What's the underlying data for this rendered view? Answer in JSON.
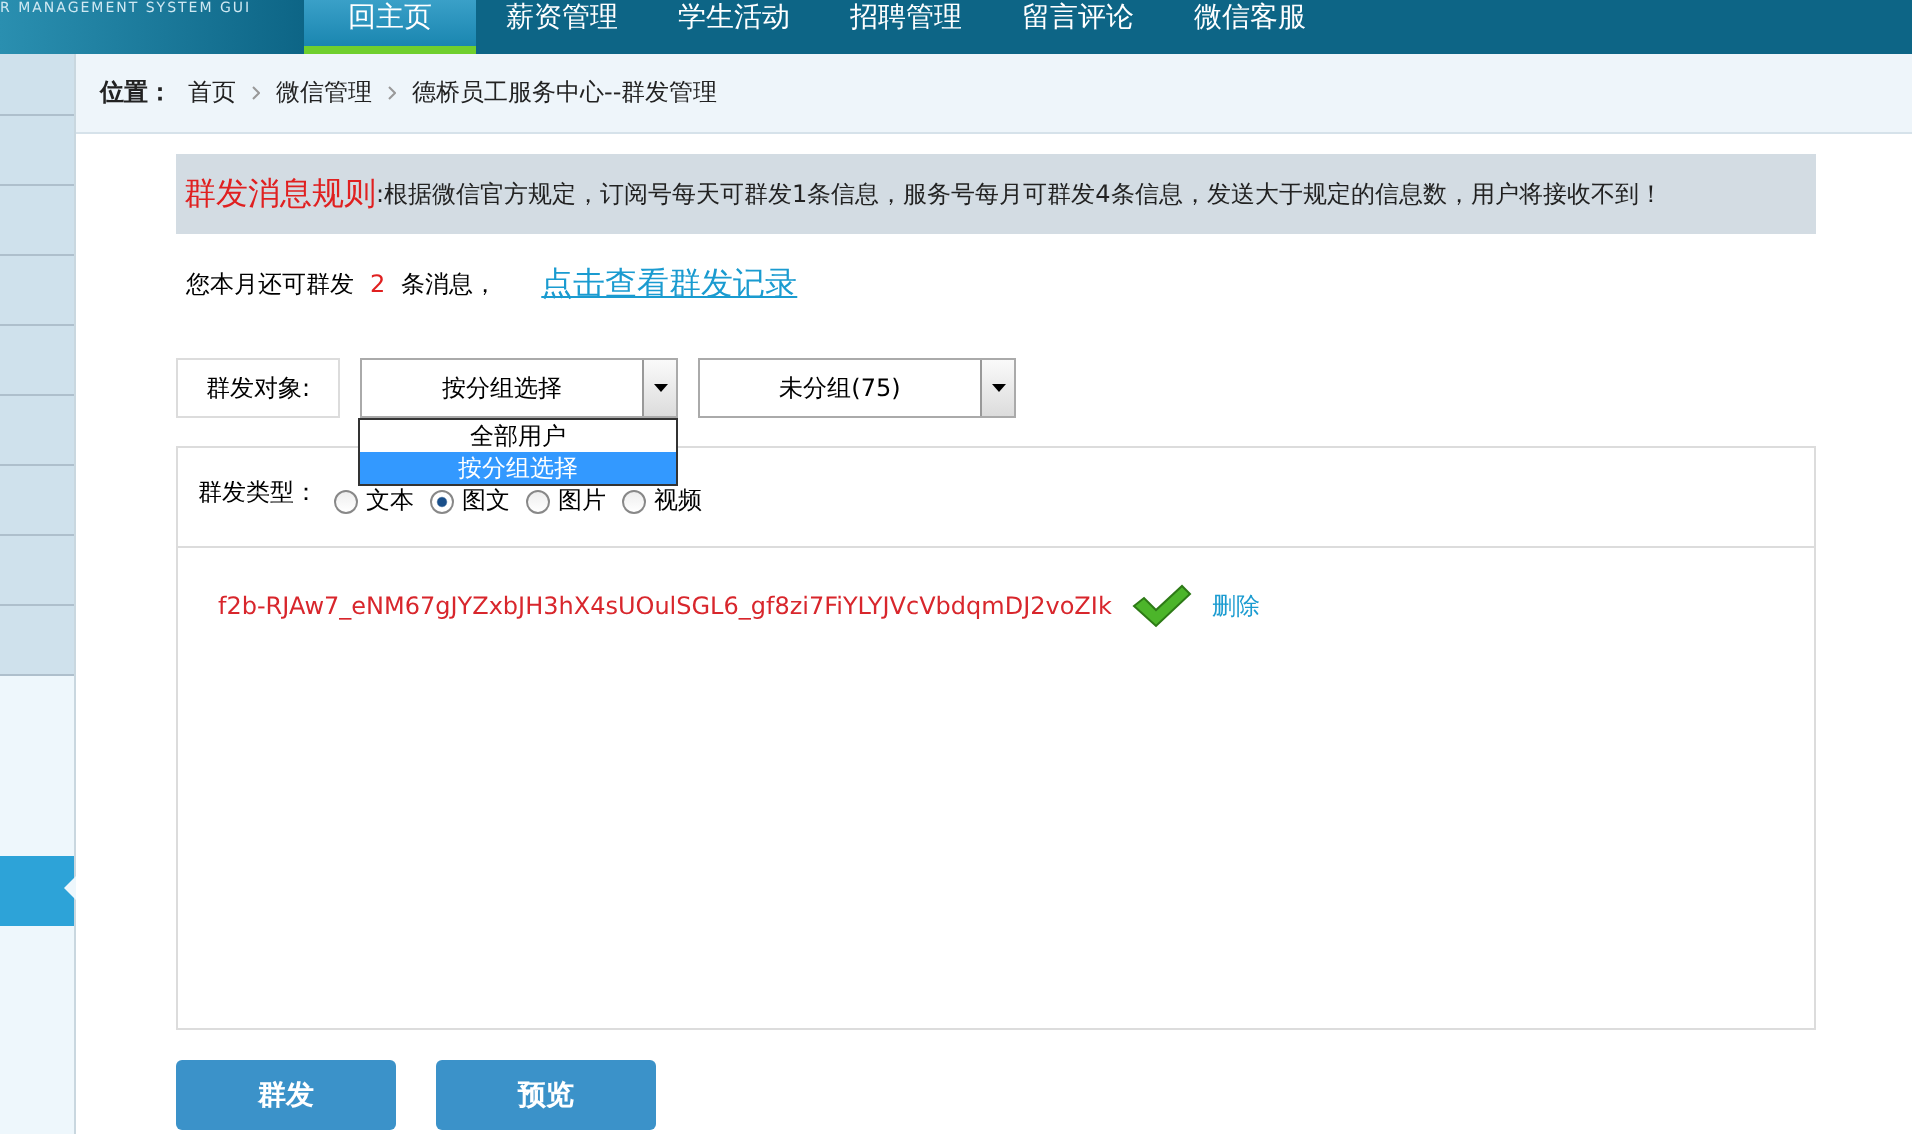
{
  "header": {
    "logo_text": "R MANAGEMENT SYSTEM GUI",
    "nav": [
      {
        "label": "回主页",
        "selected": true
      },
      {
        "label": "薪资管理",
        "selected": false
      },
      {
        "label": "学生活动",
        "selected": false
      },
      {
        "label": "招聘管理",
        "selected": false
      },
      {
        "label": "留言评论",
        "selected": false
      },
      {
        "label": "微信客服",
        "selected": false
      }
    ]
  },
  "sidebar": {
    "items": [
      {
        "selected": false
      },
      {
        "selected": false
      },
      {
        "selected": false
      },
      {
        "selected": false
      },
      {
        "selected": false
      },
      {
        "selected": false
      },
      {
        "selected": false
      },
      {
        "selected": false
      },
      {
        "selected": true
      }
    ]
  },
  "breadcrumb": {
    "label": "位置：",
    "items": [
      "首页",
      "微信管理",
      "德桥员工服务中心--群发管理"
    ]
  },
  "rule": {
    "title": "群发消息规则",
    "text": ":根据微信官方规定，订阅号每天可群发1条信息，服务号每月可群发4条信息，发送大于规定的信息数，用户将接收不到！"
  },
  "quota": {
    "prefix": "您本月还可群发",
    "count": "2",
    "suffix": "条消息，",
    "link": "点击查看群发记录"
  },
  "target": {
    "label": "群发对象:",
    "select": {
      "value": "按分组选择",
      "expanded": true,
      "options": [
        {
          "label": "全部用户",
          "selected": false
        },
        {
          "label": "按分组选择",
          "selected": true
        }
      ]
    },
    "group_select": {
      "value": "未分组(75)"
    }
  },
  "types": {
    "label": "群发类型：",
    "options": [
      {
        "label": "文本",
        "selected": false
      },
      {
        "label": "图文",
        "selected": true
      },
      {
        "label": "图片",
        "selected": false
      },
      {
        "label": "视频",
        "selected": false
      }
    ]
  },
  "media": {
    "id": "f2b-RJAw7_eNM67gJYZxbJH3hX4sUOulSGL6_gf8zi7FiYLYJVcVbdqmDJ2voZIk",
    "delete": "删除"
  },
  "buttons": [
    "群发",
    "预览"
  ]
}
